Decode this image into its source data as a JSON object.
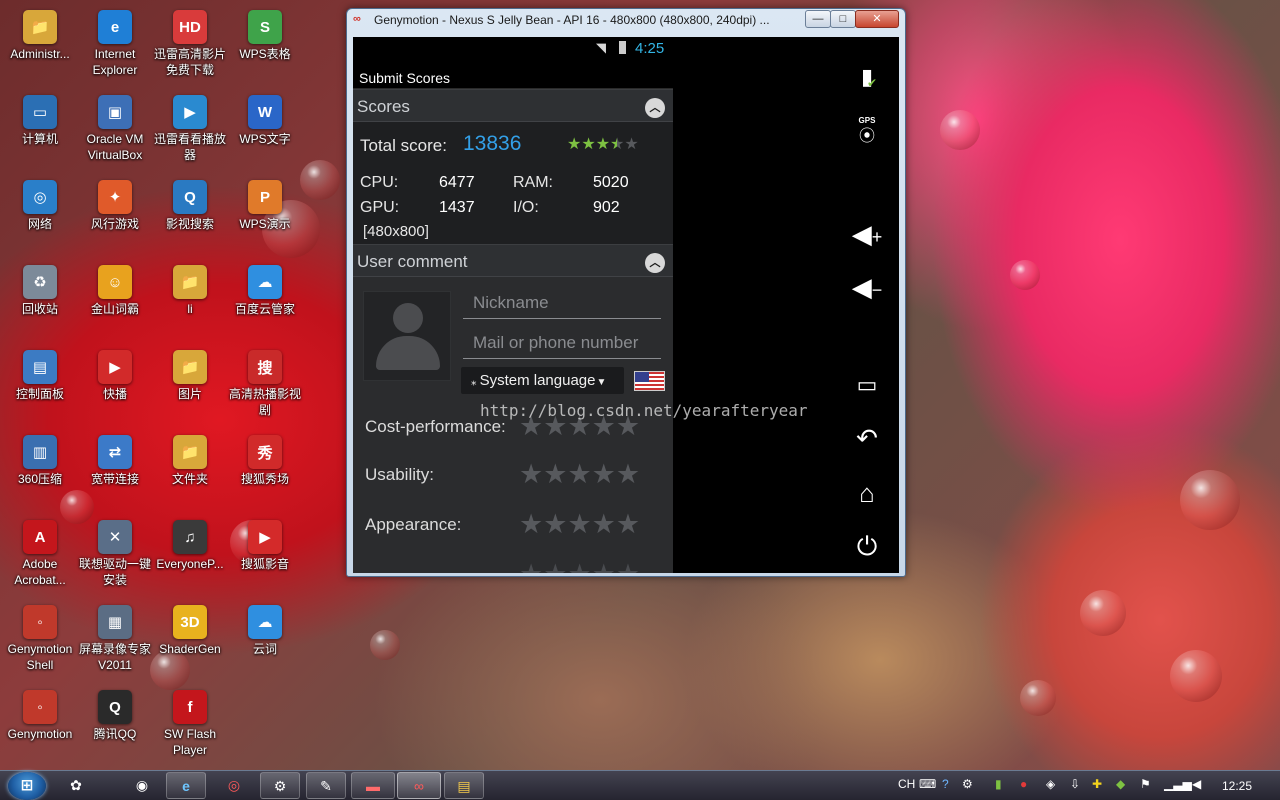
{
  "desktop": {
    "icons": [
      {
        "label": "Administr...",
        "glyph": "📁",
        "color": "#d8a73a"
      },
      {
        "label": "Internet Explorer",
        "glyph": "e",
        "color": "#1f7fd6"
      },
      {
        "label": "迅雷高清影片免费下载",
        "glyph": "HD",
        "color": "#d93b3b"
      },
      {
        "label": "WPS表格",
        "glyph": "S",
        "color": "#3fa34a"
      },
      {
        "label": "计算机",
        "glyph": "▭",
        "color": "#2b6fb4"
      },
      {
        "label": "Oracle VM VirtualBox",
        "glyph": "▣",
        "color": "#3d6fb6"
      },
      {
        "label": "迅雷看看播放器",
        "glyph": "▶",
        "color": "#2a8ad0"
      },
      {
        "label": "WPS文字",
        "glyph": "W",
        "color": "#2a66c8"
      },
      {
        "label": "网络",
        "glyph": "◎",
        "color": "#2a7fc9"
      },
      {
        "label": "风行游戏",
        "glyph": "✦",
        "color": "#e05a2a"
      },
      {
        "label": "影视搜索",
        "glyph": "Q",
        "color": "#2a7ac2"
      },
      {
        "label": "WPS演示",
        "glyph": "P",
        "color": "#e07a2a"
      },
      {
        "label": "回收站",
        "glyph": "♻",
        "color": "#7c8a99"
      },
      {
        "label": "金山词霸",
        "glyph": "☺",
        "color": "#e8a21e"
      },
      {
        "label": "li",
        "glyph": "📁",
        "color": "#d8a73a"
      },
      {
        "label": "百度云管家",
        "glyph": "☁",
        "color": "#2f8fe0"
      },
      {
        "label": "控制面板",
        "glyph": "▤",
        "color": "#3c7bc3"
      },
      {
        "label": "快播",
        "glyph": "▶",
        "color": "#d22a2a"
      },
      {
        "label": "图片",
        "glyph": "📁",
        "color": "#d8a73a"
      },
      {
        "label": "高清热播影视剧",
        "glyph": "搜",
        "color": "#c92a2a"
      },
      {
        "label": "360压缩",
        "glyph": "▥",
        "color": "#3a6fb0"
      },
      {
        "label": "宽带连接",
        "glyph": "⇄",
        "color": "#3c7ac8"
      },
      {
        "label": "文件夹",
        "glyph": "📁",
        "color": "#d8a73a"
      },
      {
        "label": "搜狐秀场",
        "glyph": "秀",
        "color": "#d12a2a"
      },
      {
        "label": "Adobe Acrobat...",
        "glyph": "A",
        "color": "#c4161c"
      },
      {
        "label": "联想驱动一键安装",
        "glyph": "✕",
        "color": "#5a6e88"
      },
      {
        "label": "EveryoneP...",
        "glyph": "♫",
        "color": "#3a3a3a"
      },
      {
        "label": "搜狐影音",
        "glyph": "▶",
        "color": "#d42a2a"
      },
      {
        "label": "Genymotion Shell",
        "glyph": "◦",
        "color": "#c0392b"
      },
      {
        "label": "屏幕录像专家V2011",
        "glyph": "▦",
        "color": "#5b6d84"
      },
      {
        "label": "ShaderGen",
        "glyph": "3D",
        "color": "#e8b21e"
      },
      {
        "label": "云词",
        "glyph": "☁",
        "color": "#2f8fe0"
      },
      {
        "label": "Genymotion",
        "glyph": "◦",
        "color": "#c0392b"
      },
      {
        "label": "腾讯QQ",
        "glyph": "Q",
        "color": "#2a2a2a"
      },
      {
        "label": "SW Flash Player",
        "glyph": "f",
        "color": "#c4161c"
      }
    ]
  },
  "window": {
    "title": "Genymotion - Nexus S Jelly Bean - API 16 - 480x800 (480x800, 240dpi) ...",
    "title_icon": "∞",
    "minimize": "—",
    "maximize": "□",
    "close": "✕"
  },
  "android": {
    "time": "4:25",
    "actionbar_title": "Submit Scores",
    "scores": {
      "header": "Scores",
      "total_label": "Total score:",
      "total_value": "13836",
      "total_rating": 3.5,
      "cpu_label": "CPU:",
      "cpu_value": "6477",
      "ram_label": "RAM:",
      "ram_value": "5020",
      "gpu_label": "GPU:",
      "gpu_value": "1437",
      "io_label": "I/O:",
      "io_value": "902",
      "resolution": "[480x800]"
    },
    "comment": {
      "header": "User comment",
      "nickname_placeholder": "Nickname",
      "mail_placeholder": "Mail or phone number",
      "language": "System language",
      "ratings": [
        {
          "label": "Cost-performance:",
          "stars": 0
        },
        {
          "label": "Usability:",
          "stars": 0
        },
        {
          "label": "Appearance:",
          "stars": 0
        }
      ]
    }
  },
  "watermark": "http://blog.csdn.net/yearafteryear",
  "genymotion_panel": {
    "battery_icon": "battery-icon",
    "gps_label": "GPS",
    "volume_up_icon": "volume-up-icon",
    "volume_down_icon": "volume-down-icon",
    "recent_apps_icon": "recent-apps-icon",
    "back_icon": "back-icon",
    "home_icon": "home-icon",
    "power_icon": "power-icon"
  },
  "taskbar": {
    "clock": "12:25",
    "ime": "CH"
  },
  "colors": {
    "accent_blue": "#33a0e8",
    "star_green": "#7ec242",
    "star_empty": "#57595d",
    "status_time": "#33b5e5"
  }
}
